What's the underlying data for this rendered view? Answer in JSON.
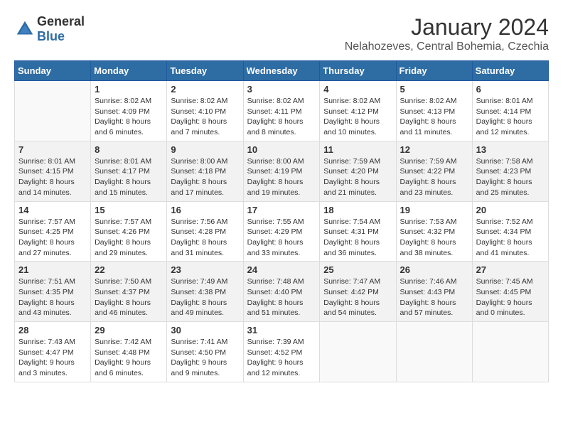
{
  "header": {
    "logo_general": "General",
    "logo_blue": "Blue",
    "month_title": "January 2024",
    "location": "Nelahozeves, Central Bohemia, Czechia"
  },
  "days_of_week": [
    "Sunday",
    "Monday",
    "Tuesday",
    "Wednesday",
    "Thursday",
    "Friday",
    "Saturday"
  ],
  "weeks": [
    {
      "shaded": false,
      "days": [
        {
          "number": "",
          "empty": true
        },
        {
          "number": "1",
          "sunrise": "Sunrise: 8:02 AM",
          "sunset": "Sunset: 4:09 PM",
          "daylight": "Daylight: 8 hours and 6 minutes."
        },
        {
          "number": "2",
          "sunrise": "Sunrise: 8:02 AM",
          "sunset": "Sunset: 4:10 PM",
          "daylight": "Daylight: 8 hours and 7 minutes."
        },
        {
          "number": "3",
          "sunrise": "Sunrise: 8:02 AM",
          "sunset": "Sunset: 4:11 PM",
          "daylight": "Daylight: 8 hours and 8 minutes."
        },
        {
          "number": "4",
          "sunrise": "Sunrise: 8:02 AM",
          "sunset": "Sunset: 4:12 PM",
          "daylight": "Daylight: 8 hours and 10 minutes."
        },
        {
          "number": "5",
          "sunrise": "Sunrise: 8:02 AM",
          "sunset": "Sunset: 4:13 PM",
          "daylight": "Daylight: 8 hours and 11 minutes."
        },
        {
          "number": "6",
          "sunrise": "Sunrise: 8:01 AM",
          "sunset": "Sunset: 4:14 PM",
          "daylight": "Daylight: 8 hours and 12 minutes."
        }
      ]
    },
    {
      "shaded": true,
      "days": [
        {
          "number": "7",
          "sunrise": "Sunrise: 8:01 AM",
          "sunset": "Sunset: 4:15 PM",
          "daylight": "Daylight: 8 hours and 14 minutes."
        },
        {
          "number": "8",
          "sunrise": "Sunrise: 8:01 AM",
          "sunset": "Sunset: 4:17 PM",
          "daylight": "Daylight: 8 hours and 15 minutes."
        },
        {
          "number": "9",
          "sunrise": "Sunrise: 8:00 AM",
          "sunset": "Sunset: 4:18 PM",
          "daylight": "Daylight: 8 hours and 17 minutes."
        },
        {
          "number": "10",
          "sunrise": "Sunrise: 8:00 AM",
          "sunset": "Sunset: 4:19 PM",
          "daylight": "Daylight: 8 hours and 19 minutes."
        },
        {
          "number": "11",
          "sunrise": "Sunrise: 7:59 AM",
          "sunset": "Sunset: 4:20 PM",
          "daylight": "Daylight: 8 hours and 21 minutes."
        },
        {
          "number": "12",
          "sunrise": "Sunrise: 7:59 AM",
          "sunset": "Sunset: 4:22 PM",
          "daylight": "Daylight: 8 hours and 23 minutes."
        },
        {
          "number": "13",
          "sunrise": "Sunrise: 7:58 AM",
          "sunset": "Sunset: 4:23 PM",
          "daylight": "Daylight: 8 hours and 25 minutes."
        }
      ]
    },
    {
      "shaded": false,
      "days": [
        {
          "number": "14",
          "sunrise": "Sunrise: 7:57 AM",
          "sunset": "Sunset: 4:25 PM",
          "daylight": "Daylight: 8 hours and 27 minutes."
        },
        {
          "number": "15",
          "sunrise": "Sunrise: 7:57 AM",
          "sunset": "Sunset: 4:26 PM",
          "daylight": "Daylight: 8 hours and 29 minutes."
        },
        {
          "number": "16",
          "sunrise": "Sunrise: 7:56 AM",
          "sunset": "Sunset: 4:28 PM",
          "daylight": "Daylight: 8 hours and 31 minutes."
        },
        {
          "number": "17",
          "sunrise": "Sunrise: 7:55 AM",
          "sunset": "Sunset: 4:29 PM",
          "daylight": "Daylight: 8 hours and 33 minutes."
        },
        {
          "number": "18",
          "sunrise": "Sunrise: 7:54 AM",
          "sunset": "Sunset: 4:31 PM",
          "daylight": "Daylight: 8 hours and 36 minutes."
        },
        {
          "number": "19",
          "sunrise": "Sunrise: 7:53 AM",
          "sunset": "Sunset: 4:32 PM",
          "daylight": "Daylight: 8 hours and 38 minutes."
        },
        {
          "number": "20",
          "sunrise": "Sunrise: 7:52 AM",
          "sunset": "Sunset: 4:34 PM",
          "daylight": "Daylight: 8 hours and 41 minutes."
        }
      ]
    },
    {
      "shaded": true,
      "days": [
        {
          "number": "21",
          "sunrise": "Sunrise: 7:51 AM",
          "sunset": "Sunset: 4:35 PM",
          "daylight": "Daylight: 8 hours and 43 minutes."
        },
        {
          "number": "22",
          "sunrise": "Sunrise: 7:50 AM",
          "sunset": "Sunset: 4:37 PM",
          "daylight": "Daylight: 8 hours and 46 minutes."
        },
        {
          "number": "23",
          "sunrise": "Sunrise: 7:49 AM",
          "sunset": "Sunset: 4:38 PM",
          "daylight": "Daylight: 8 hours and 49 minutes."
        },
        {
          "number": "24",
          "sunrise": "Sunrise: 7:48 AM",
          "sunset": "Sunset: 4:40 PM",
          "daylight": "Daylight: 8 hours and 51 minutes."
        },
        {
          "number": "25",
          "sunrise": "Sunrise: 7:47 AM",
          "sunset": "Sunset: 4:42 PM",
          "daylight": "Daylight: 8 hours and 54 minutes."
        },
        {
          "number": "26",
          "sunrise": "Sunrise: 7:46 AM",
          "sunset": "Sunset: 4:43 PM",
          "daylight": "Daylight: 8 hours and 57 minutes."
        },
        {
          "number": "27",
          "sunrise": "Sunrise: 7:45 AM",
          "sunset": "Sunset: 4:45 PM",
          "daylight": "Daylight: 9 hours and 0 minutes."
        }
      ]
    },
    {
      "shaded": false,
      "days": [
        {
          "number": "28",
          "sunrise": "Sunrise: 7:43 AM",
          "sunset": "Sunset: 4:47 PM",
          "daylight": "Daylight: 9 hours and 3 minutes."
        },
        {
          "number": "29",
          "sunrise": "Sunrise: 7:42 AM",
          "sunset": "Sunset: 4:48 PM",
          "daylight": "Daylight: 9 hours and 6 minutes."
        },
        {
          "number": "30",
          "sunrise": "Sunrise: 7:41 AM",
          "sunset": "Sunset: 4:50 PM",
          "daylight": "Daylight: 9 hours and 9 minutes."
        },
        {
          "number": "31",
          "sunrise": "Sunrise: 7:39 AM",
          "sunset": "Sunset: 4:52 PM",
          "daylight": "Daylight: 9 hours and 12 minutes."
        },
        {
          "number": "",
          "empty": true
        },
        {
          "number": "",
          "empty": true
        },
        {
          "number": "",
          "empty": true
        }
      ]
    }
  ]
}
